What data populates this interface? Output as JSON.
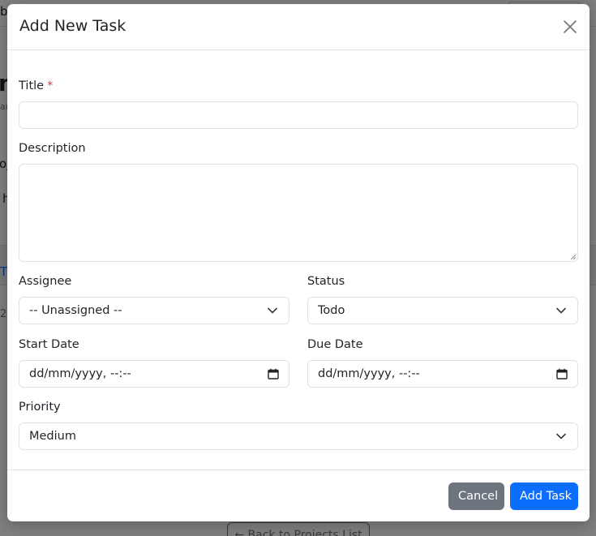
{
  "modal": {
    "title": "Add New Task",
    "fields": {
      "title": {
        "label": "Title",
        "required_mark": "*",
        "value": ""
      },
      "description": {
        "label": "Description",
        "value": ""
      },
      "assignee": {
        "label": "Assignee",
        "value": "-- Unassigned --"
      },
      "status": {
        "label": "Status",
        "value": "Todo"
      },
      "start_date": {
        "label": "Start Date",
        "value": "dd/mm/yyyy, --:--"
      },
      "due_date": {
        "label": "Due Date",
        "value": "dd/mm/yyyy, --:--"
      },
      "priority": {
        "label": "Priority",
        "value": "Medium"
      }
    },
    "buttons": {
      "cancel": "Cancel",
      "add": "Add Task"
    }
  },
  "background": {
    "top_fragment": "b",
    "heading_fragment": "n",
    "sub_fragment": "an",
    "section_fragment": "oj",
    "item_fragment": "h",
    "link_fragment": "T",
    "row_fragment": "2",
    "back_button": "← Back to Projects List"
  },
  "colors": {
    "primary": "#0d6efd",
    "secondary": "#6c757d",
    "required": "#dc3545",
    "border": "#dee2e6"
  },
  "icons": {
    "close": "close-icon",
    "chevron": "chevron-down-icon",
    "calendar": "calendar-icon"
  }
}
